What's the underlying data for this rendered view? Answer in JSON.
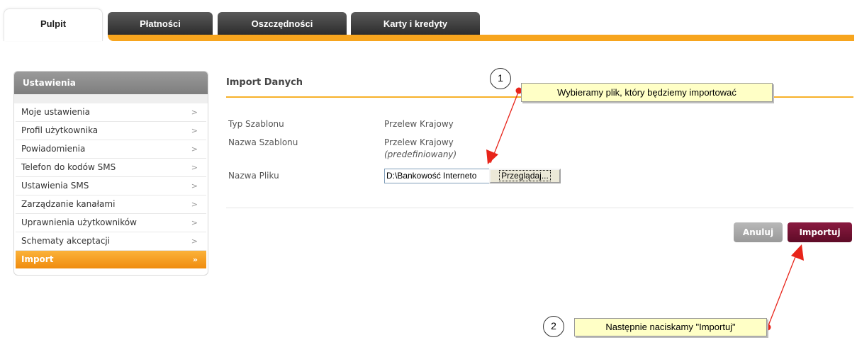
{
  "tabs": [
    {
      "label": "Pulpit",
      "active": true
    },
    {
      "label": "Płatności",
      "active": false
    },
    {
      "label": "Oszczędności",
      "active": false
    },
    {
      "label": "Karty i kredyty",
      "active": false
    }
  ],
  "sidebar": {
    "title": "Ustawienia",
    "items": [
      {
        "label": "Moje ustawienia",
        "chevron": ">"
      },
      {
        "label": "Profil użytkownika",
        "chevron": ">"
      },
      {
        "label": "Powiadomienia",
        "chevron": ">"
      },
      {
        "label": "Telefon do kodów SMS",
        "chevron": ">"
      },
      {
        "label": "Ustawienia SMS",
        "chevron": ">"
      },
      {
        "label": "Zarządzanie kanałami",
        "chevron": ">"
      },
      {
        "label": "Uprawnienia użytkowników",
        "chevron": ">"
      },
      {
        "label": "Schematy akceptacji",
        "chevron": ">"
      },
      {
        "label": "Import",
        "chevron": "»",
        "active": true
      }
    ]
  },
  "main": {
    "title": "Import Danych",
    "fields": [
      {
        "label": "Typ Szablonu",
        "value": "Przelew Krajowy"
      },
      {
        "label": "Nazwa Szablonu",
        "value": "Przelew Krajowy",
        "note": "(predefiniowany)"
      },
      {
        "label": "Nazwa Pliku",
        "value": "D:\\Bankowość Interneto"
      }
    ],
    "browse_label": "Przeglądaj...",
    "cancel_label": "Anuluj",
    "import_label": "Importuj"
  },
  "annotations": [
    {
      "number": "1",
      "text": "Wybieramy plik, który będziemy importować"
    },
    {
      "number": "2",
      "text": "Następnie naciskamy \"Importuj\""
    }
  ],
  "colors": {
    "accent_orange": "#f7a51e",
    "import_button": "#6e1030",
    "cancel_button": "#a8a8a8",
    "arrow": "#e8241a",
    "note_background": "#ffffc6"
  }
}
